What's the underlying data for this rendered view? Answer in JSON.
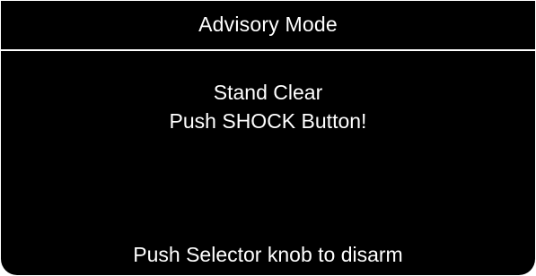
{
  "header": {
    "mode_title": "Advisory Mode"
  },
  "message": {
    "line1": "Stand Clear",
    "line2": "Push SHOCK Button!"
  },
  "footer": {
    "prompt": "Push Selector knob to disarm"
  },
  "colors": {
    "background": "#000000",
    "text": "#ffffff",
    "frame": "#ffffff"
  }
}
